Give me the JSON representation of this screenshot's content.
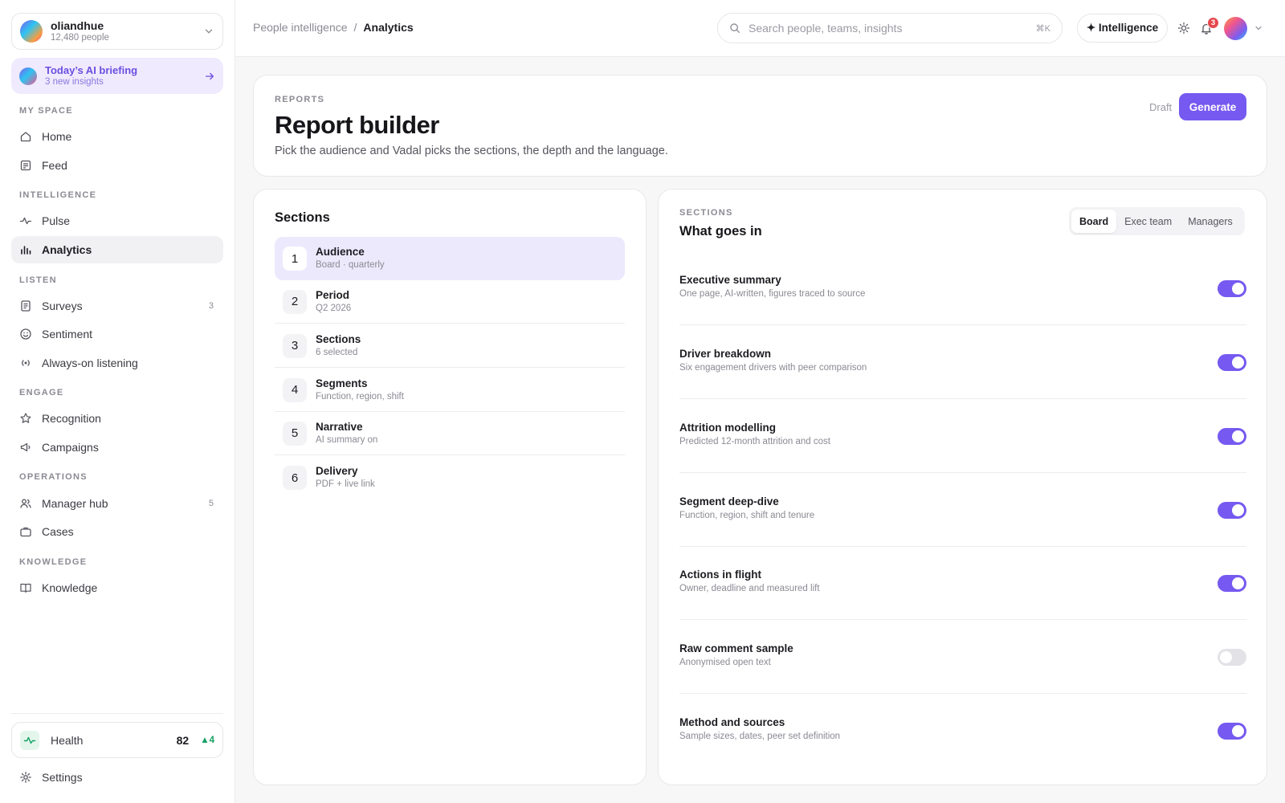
{
  "workspace": {
    "name": "oliandhue",
    "sub": "12,480 people"
  },
  "briefing": {
    "title": "Today’s AI briefing",
    "sub": "3 new insights"
  },
  "nav": {
    "my_space": "MY SPACE",
    "home": "Home",
    "feed": "Feed",
    "intelligence": "INTELLIGENCE",
    "pulse": "Pulse",
    "analytics": "Analytics",
    "listen": "LISTEN",
    "surveys": "Surveys",
    "surveys_count": "3",
    "sentiment": "Sentiment",
    "always_on": "Always-on listening",
    "engage": "ENGAGE",
    "recognition": "Recognition",
    "campaigns": "Campaigns",
    "operations": "OPERATIONS",
    "manager_hub": "Manager hub",
    "manager_hub_count": "5",
    "cases": "Cases",
    "knowledge_section": "KNOWLEDGE",
    "knowledge": "Knowledge",
    "settings": "Settings"
  },
  "health": {
    "label": "Health",
    "score": "82",
    "delta": "▲4"
  },
  "topbar": {
    "breadcrumb_parent": "People intelligence",
    "breadcrumb_sep": "/",
    "breadcrumb_current": "Analytics",
    "search_placeholder": "Search people, teams, insights",
    "search_kbd": "⌘K",
    "intelligence_label": "✦ Intelligence",
    "notif_count": "3"
  },
  "header": {
    "eyebrow": "REPORTS",
    "title": "Report builder",
    "desc": "Pick the audience and Vadal picks the sections, the depth and the language.",
    "status": "Draft",
    "generate": "Generate"
  },
  "steps": {
    "heading": "Sections",
    "items": [
      {
        "num": "1",
        "title": "Audience",
        "sub": "Board · quarterly"
      },
      {
        "num": "2",
        "title": "Period",
        "sub": "Q2 2026"
      },
      {
        "num": "3",
        "title": "Sections",
        "sub": "6 selected"
      },
      {
        "num": "4",
        "title": "Segments",
        "sub": "Function, region, shift"
      },
      {
        "num": "5",
        "title": "Narrative",
        "sub": "AI summary on"
      },
      {
        "num": "6",
        "title": "Delivery",
        "sub": "PDF + live link"
      }
    ]
  },
  "content": {
    "eyebrow": "SECTIONS",
    "heading": "What goes in",
    "tabs": [
      "Board",
      "Exec team",
      "Managers"
    ],
    "rows": [
      {
        "title": "Executive summary",
        "desc": "One page, AI-written, figures traced to source",
        "on": true
      },
      {
        "title": "Driver breakdown",
        "desc": "Six engagement drivers with peer comparison",
        "on": true
      },
      {
        "title": "Attrition modelling",
        "desc": "Predicted 12-month attrition and cost",
        "on": true
      },
      {
        "title": "Segment deep-dive",
        "desc": "Function, region, shift and tenure",
        "on": true
      },
      {
        "title": "Actions in flight",
        "desc": "Owner, deadline and measured lift",
        "on": true
      },
      {
        "title": "Raw comment sample",
        "desc": "Anonymised open text",
        "on": false
      },
      {
        "title": "Method and sources",
        "desc": "Sample sizes, dates, peer set definition",
        "on": true
      }
    ]
  },
  "colors": {
    "accent": "#7659f0",
    "accent_soft": "#ede9fd",
    "positive": "#16a163",
    "alert": "#e5484d"
  }
}
